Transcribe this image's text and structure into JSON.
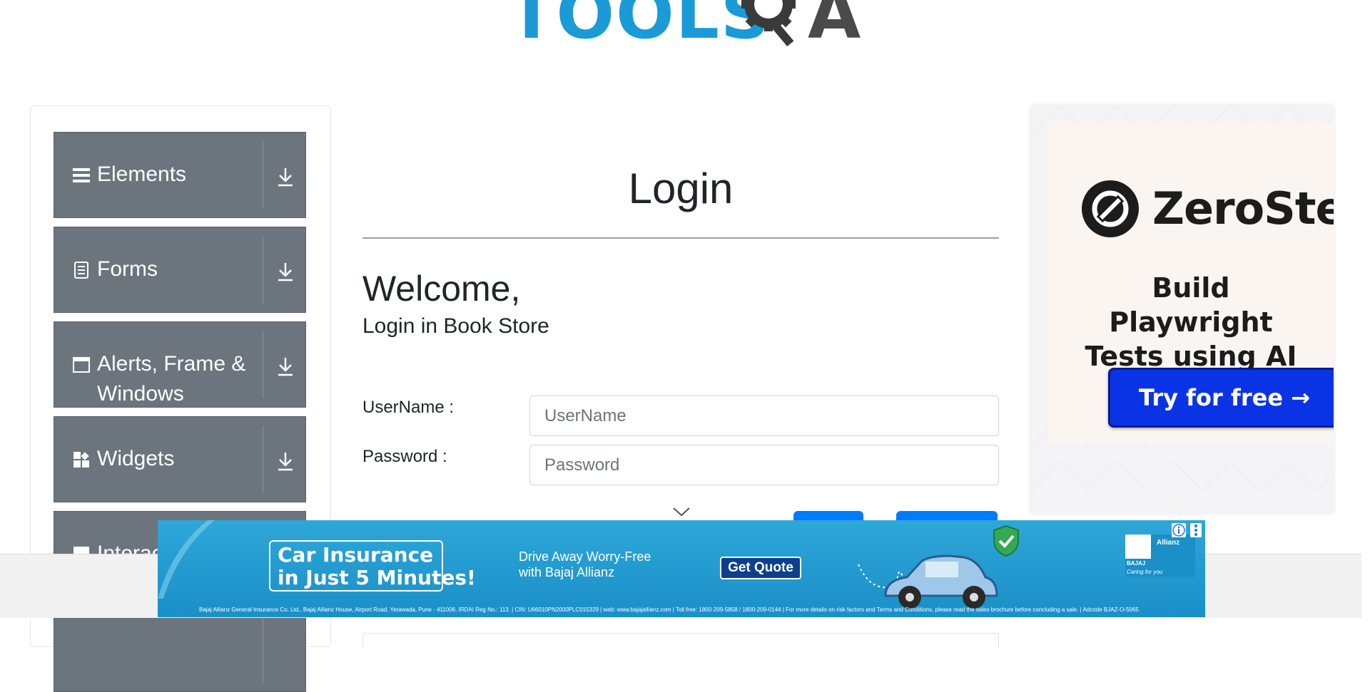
{
  "logo": {
    "text": "TOOLS",
    "suffix": "A",
    "brand_color": "#1a9ad6"
  },
  "sidebar": {
    "groups": [
      {
        "label": "Elements",
        "icon": "hamburger-icon"
      },
      {
        "label": "Forms",
        "icon": "form-icon"
      },
      {
        "label": "Alerts, Frame & Windows",
        "icon": "window-icon"
      },
      {
        "label": "Widgets",
        "icon": "widgets-icon"
      },
      {
        "label": "Interac",
        "icon": "interactions-icon"
      }
    ],
    "arrow_icon": "download-arrow-icon",
    "color": "#6c757d"
  },
  "main": {
    "title": "Login",
    "welcome": "Welcome,",
    "subtitle": "Login in Book Store",
    "username": {
      "label": "UserName :",
      "placeholder": "UserName"
    },
    "password": {
      "label": "Password :",
      "placeholder": "Password"
    },
    "button_color": "#007bff"
  },
  "right_ad": {
    "brand": "ZeroStep",
    "headline_1": "Build Playwright",
    "headline_2": "Tests using AI",
    "cta": "Try for free →",
    "cta_color": "#0b33e6"
  },
  "bottom_ad": {
    "headline_1": "Car Insurance",
    "headline_2": "in Just 5 Minutes!",
    "tagline_1": "Drive Away Worry-Free",
    "tagline_2": "with Bajaj Allianz",
    "cta": "Get Quote",
    "logo_text_1": "BAJAJ",
    "logo_text_2": "Allianz",
    "logo_tagline": "Caring for you",
    "fineprint": "Bajaj Allianz General Insurance Co. Ltd., Bajaj Allianz House, Airport Road, Yerawada, Pune - 411006. IRDAI Reg No.: 113. | CIN: U66010PN2000PLC015329 | web: www.bajajallianz.com | Toll free: 1800-209-5858 / 1800-209-0144 | For more details on risk factors and Terms and Conditions, please read the sales brochure before concluding a sale. | Adcode BJAZ-O-5065",
    "info_icon": "info-icon",
    "menu_icon": "more-vertical-icon"
  }
}
